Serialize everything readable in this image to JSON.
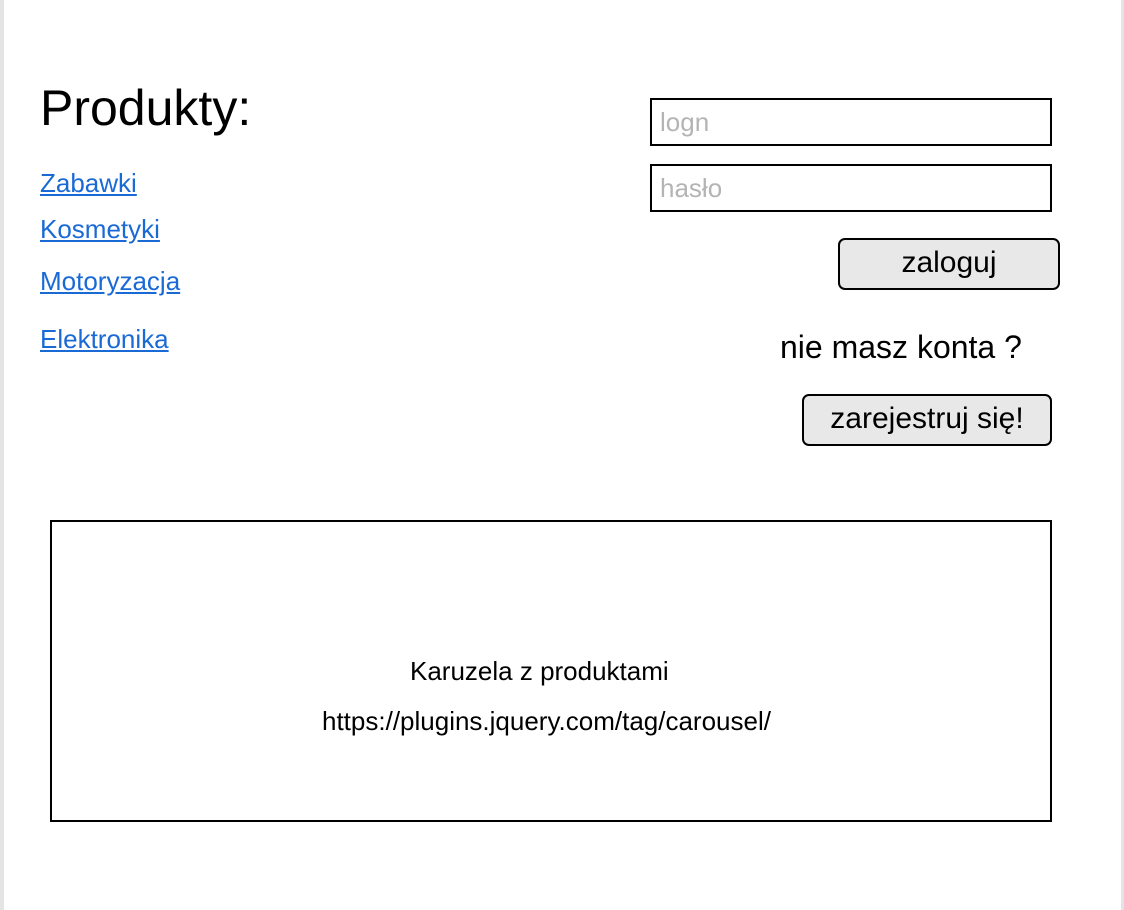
{
  "products": {
    "heading": "Produkty:",
    "categories": [
      {
        "label": "Zabawki"
      },
      {
        "label": "Kosmetyki"
      },
      {
        "label": "Motoryzacja"
      },
      {
        "label": "Elektronika"
      }
    ]
  },
  "login": {
    "login_placeholder": "logn",
    "password_placeholder": "hasło",
    "login_button": "zaloguj",
    "no_account_text": "nie masz konta ?",
    "register_button": "zarejestruj się!"
  },
  "carousel": {
    "title": "Karuzela z produktami",
    "link": "https://plugins.jquery.com/tag/carousel/"
  },
  "colors": {
    "link": "#1a6ad6",
    "button_bg": "#e8e8e8",
    "placeholder": "#b4b4b4"
  }
}
